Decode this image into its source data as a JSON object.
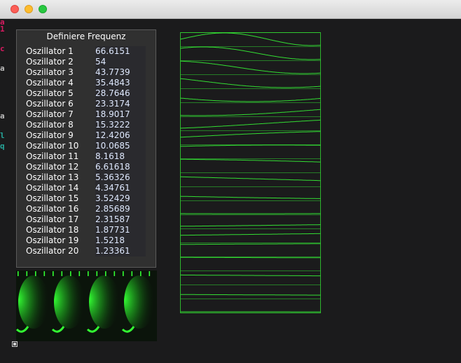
{
  "panel": {
    "title": "Definiere Frequenz",
    "oscillators": [
      {
        "label": "Oszillator 1",
        "value": "66.6151"
      },
      {
        "label": "Oszillator 2",
        "value": "54"
      },
      {
        "label": "Oszillator 3",
        "value": "43.7739"
      },
      {
        "label": "Oszillator 4",
        "value": "35.4843"
      },
      {
        "label": "Oszillator 5",
        "value": "28.7646"
      },
      {
        "label": "Oszillator 6",
        "value": "23.3174"
      },
      {
        "label": "Oszillator 7",
        "value": "18.9017"
      },
      {
        "label": "Oszillator 8",
        "value": "15.3222"
      },
      {
        "label": "Oszillator 9",
        "value": "12.4206"
      },
      {
        "label": "Oszillator 10",
        "value": "10.0685"
      },
      {
        "label": "Oszillator 11",
        "value": "8.1618"
      },
      {
        "label": "Oszillator 12",
        "value": "6.61618"
      },
      {
        "label": "Oszillator 13",
        "value": "5.36326"
      },
      {
        "label": "Oszillator 14",
        "value": "4.34761"
      },
      {
        "label": "Oszillator 15",
        "value": "3.52429"
      },
      {
        "label": "Oszillator 16",
        "value": "2.85689"
      },
      {
        "label": "Oszillator 17",
        "value": "2.31587"
      },
      {
        "label": "Oszillator 18",
        "value": "1.87731"
      },
      {
        "label": "Oszillator 19",
        "value": "1.5218"
      },
      {
        "label": "Oszillator 20",
        "value": "1.23361"
      }
    ]
  },
  "background_fragments": [
    {
      "text": "a",
      "color": "#d81b60"
    },
    {
      "text": "1",
      "color": "#d81b60"
    },
    {
      "text": "c",
      "color": "#d81b60"
    },
    {
      "text": "a",
      "color": "#bdbdbd"
    },
    {
      "text": "a",
      "color": "#bdbdbd"
    },
    {
      "text": "l",
      "color": "#26a69a"
    },
    {
      "text": "q",
      "color": "#26a69a"
    }
  ],
  "colors": {
    "wave": "#33dd33",
    "glow": "#33ff33",
    "panel_bg": "#303030",
    "window_bg": "#1b1b1c"
  }
}
